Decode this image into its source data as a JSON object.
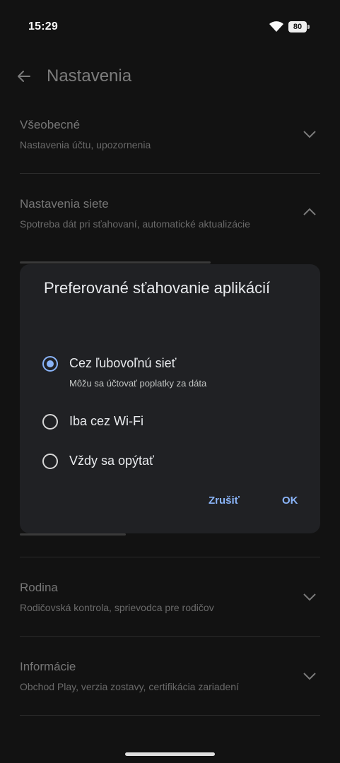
{
  "status_bar": {
    "time": "15:29",
    "battery": "80"
  },
  "app_bar": {
    "title": "Nastavenia",
    "back_icon": "arrow-left-icon"
  },
  "sections": [
    {
      "title": "Všeobecné",
      "subtitle": "Nastavenia účtu, upozornenia"
    },
    {
      "title": "Nastavenia siete",
      "subtitle": "Spotreba dát pri sťahovaní, automatické aktualizácie"
    },
    {
      "title": "Rodina",
      "subtitle": "Rodičovská kontrola, sprievodca pre rodičov"
    },
    {
      "title": "Informácie",
      "subtitle": "Obchod Play, verzia zostavy, certifikácia zariadení"
    }
  ],
  "dialog": {
    "title": "Preferované sťahovanie aplikácií",
    "options": [
      {
        "label": "Cez ľubovoľnú sieť",
        "sublabel": "Môžu sa účtovať poplatky za dáta",
        "selected": true
      },
      {
        "label": "Iba cez Wi-Fi",
        "selected": false
      },
      {
        "label": "Vždy sa opýtať",
        "selected": false
      }
    ],
    "cancel_label": "Zrušiť",
    "ok_label": "OK"
  },
  "colors": {
    "accent": "#8ab4f8",
    "dialog_bg": "#202124",
    "background": "#121212"
  }
}
